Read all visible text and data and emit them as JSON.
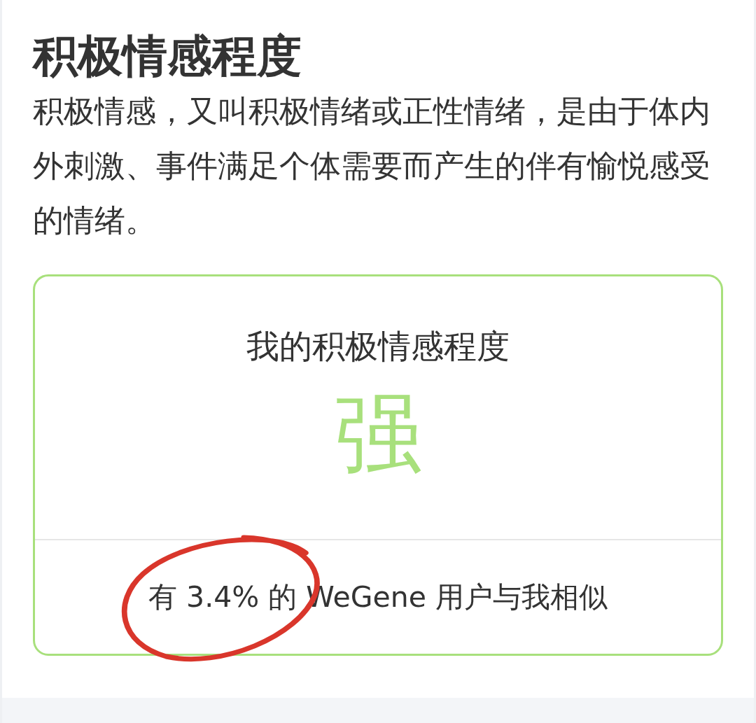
{
  "section": {
    "title": "积极情感程度",
    "description": "积极情感，又叫积极情绪或正性情绪，是由于体内外刺激、事件满足个体需要而产生的伴有愉悦感受的情绪。"
  },
  "result_card": {
    "heading": "我的积极情感程度",
    "value": "强",
    "color": "#a8e07c",
    "footer": "有 3.4% 的 WeGene 用户与我相似"
  }
}
